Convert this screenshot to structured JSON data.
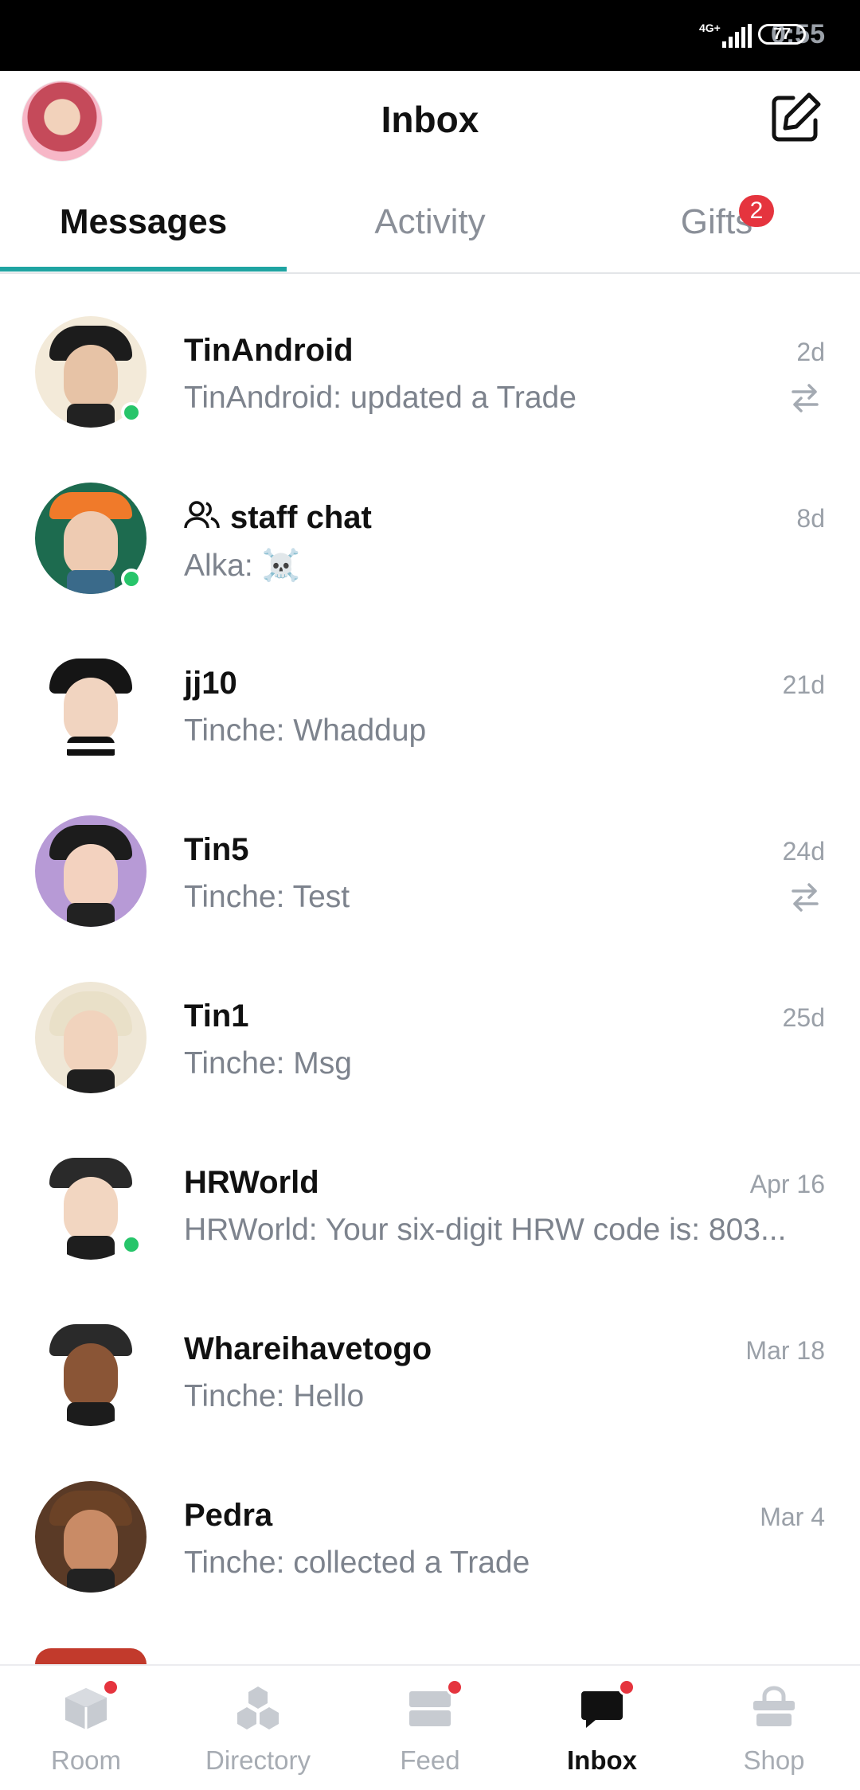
{
  "status_bar": {
    "time": "0:55",
    "network": "4G+",
    "battery": "77"
  },
  "header": {
    "title": "Inbox",
    "avatar_icon": "profile-avatar",
    "compose_icon": "compose-icon"
  },
  "tabs": [
    {
      "label": "Messages",
      "active": true
    },
    {
      "label": "Activity",
      "active": false
    },
    {
      "label": "Gifts",
      "active": false,
      "badge": "2"
    }
  ],
  "conversations": [
    {
      "name": "TinAndroid",
      "preview": "TinAndroid: updated a Trade",
      "time": "2d",
      "online": true,
      "trade_icon": true,
      "group": false
    },
    {
      "name": "staff chat",
      "preview": "Alka: ☠️",
      "time": "8d",
      "online": true,
      "trade_icon": false,
      "group": true
    },
    {
      "name": "jj10",
      "preview": "Tinche: Whaddup",
      "time": "21d",
      "online": false,
      "trade_icon": false,
      "group": false
    },
    {
      "name": "Tin5",
      "preview": "Tinche: Test",
      "time": "24d",
      "online": false,
      "trade_icon": true,
      "group": false
    },
    {
      "name": "Tin1",
      "preview": "Tinche: Msg",
      "time": "25d",
      "online": false,
      "trade_icon": false,
      "group": false
    },
    {
      "name": "HRWorld",
      "preview": "HRWorld: Your six-digit HRW code is: 803...",
      "time": "Apr 16",
      "online": true,
      "trade_icon": false,
      "group": false
    },
    {
      "name": "Whareihavetogo",
      "preview": "Tinche: Hello",
      "time": "Mar 18",
      "online": false,
      "trade_icon": false,
      "group": false
    },
    {
      "name": "Pedra",
      "preview": "Tinche: collected a Trade",
      "time": "Mar 4",
      "online": false,
      "trade_icon": false,
      "group": false
    }
  ],
  "bottom_nav": [
    {
      "label": "Room",
      "icon": "room-icon",
      "dot": true,
      "active": false
    },
    {
      "label": "Directory",
      "icon": "directory-icon",
      "dot": false,
      "active": false
    },
    {
      "label": "Feed",
      "icon": "feed-icon",
      "dot": true,
      "active": false
    },
    {
      "label": "Inbox",
      "icon": "inbox-icon",
      "dot": true,
      "active": true
    },
    {
      "label": "Shop",
      "icon": "shop-icon",
      "dot": false,
      "active": false
    }
  ],
  "colors": {
    "accent": "#1fa4a2",
    "badge": "#e5343e",
    "online": "#27c56a",
    "muted_text": "#7d838d"
  }
}
